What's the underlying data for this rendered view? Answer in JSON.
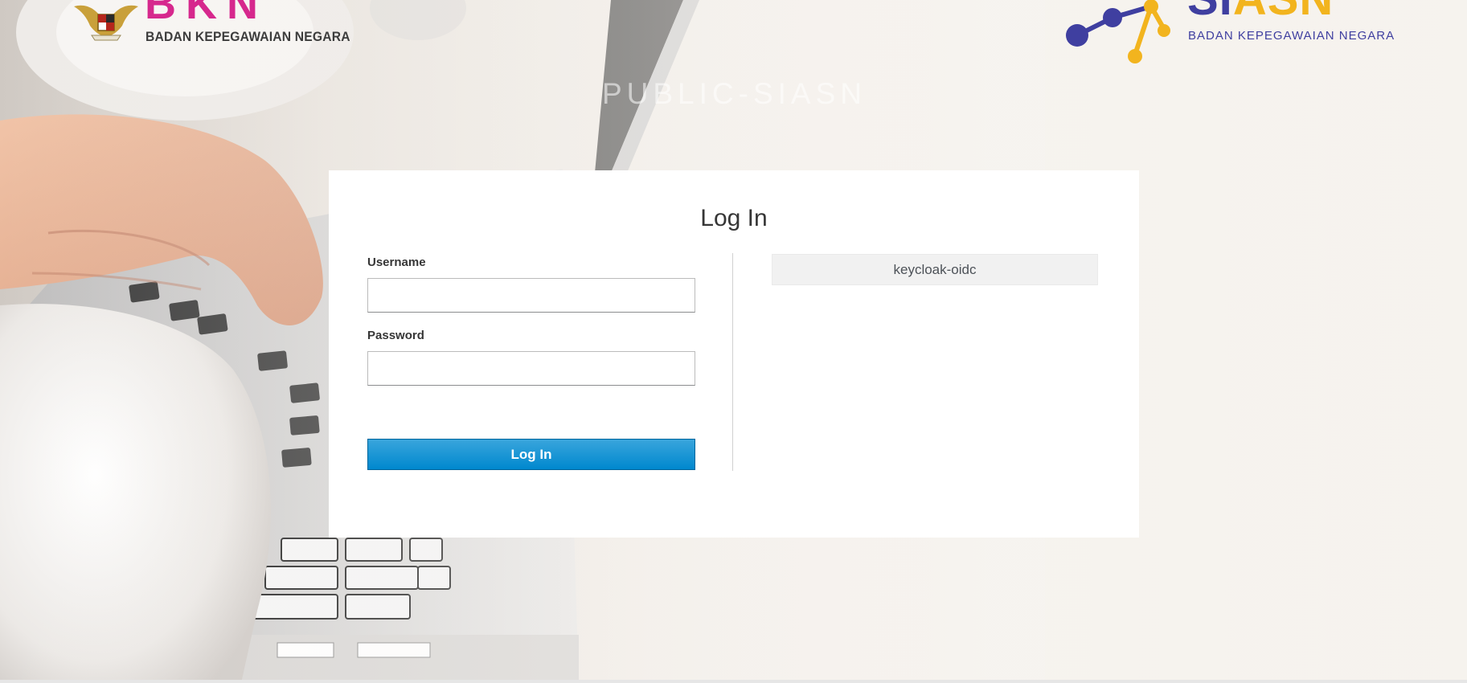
{
  "header": {
    "bkn_logo": {
      "letters": "BKN",
      "subtitle": "BADAN KEPEGAWAIAN NEGARA",
      "color": "#d6288d"
    },
    "siasn_logo": {
      "word_part1": "SI",
      "word_part2": "ASN",
      "subtitle": "BADAN KEPEGAWAIAN NEGARA",
      "colors": {
        "blue": "#3f3fa0",
        "yellow": "#f2b41e"
      }
    },
    "realm_title": "PUBLIC-SIASN"
  },
  "login": {
    "title": "Log In",
    "username": {
      "label": "Username",
      "value": "",
      "placeholder": ""
    },
    "password": {
      "label": "Password",
      "value": "",
      "placeholder": ""
    },
    "submit_label": "Log In",
    "submit_color": "#0088ce"
  },
  "identity_providers": [
    {
      "label": "keycloak-oidc"
    }
  ],
  "icons": {
    "bkn_emblem": "garuda-emblem-icon",
    "siasn_molecule": "molecule-icon"
  }
}
